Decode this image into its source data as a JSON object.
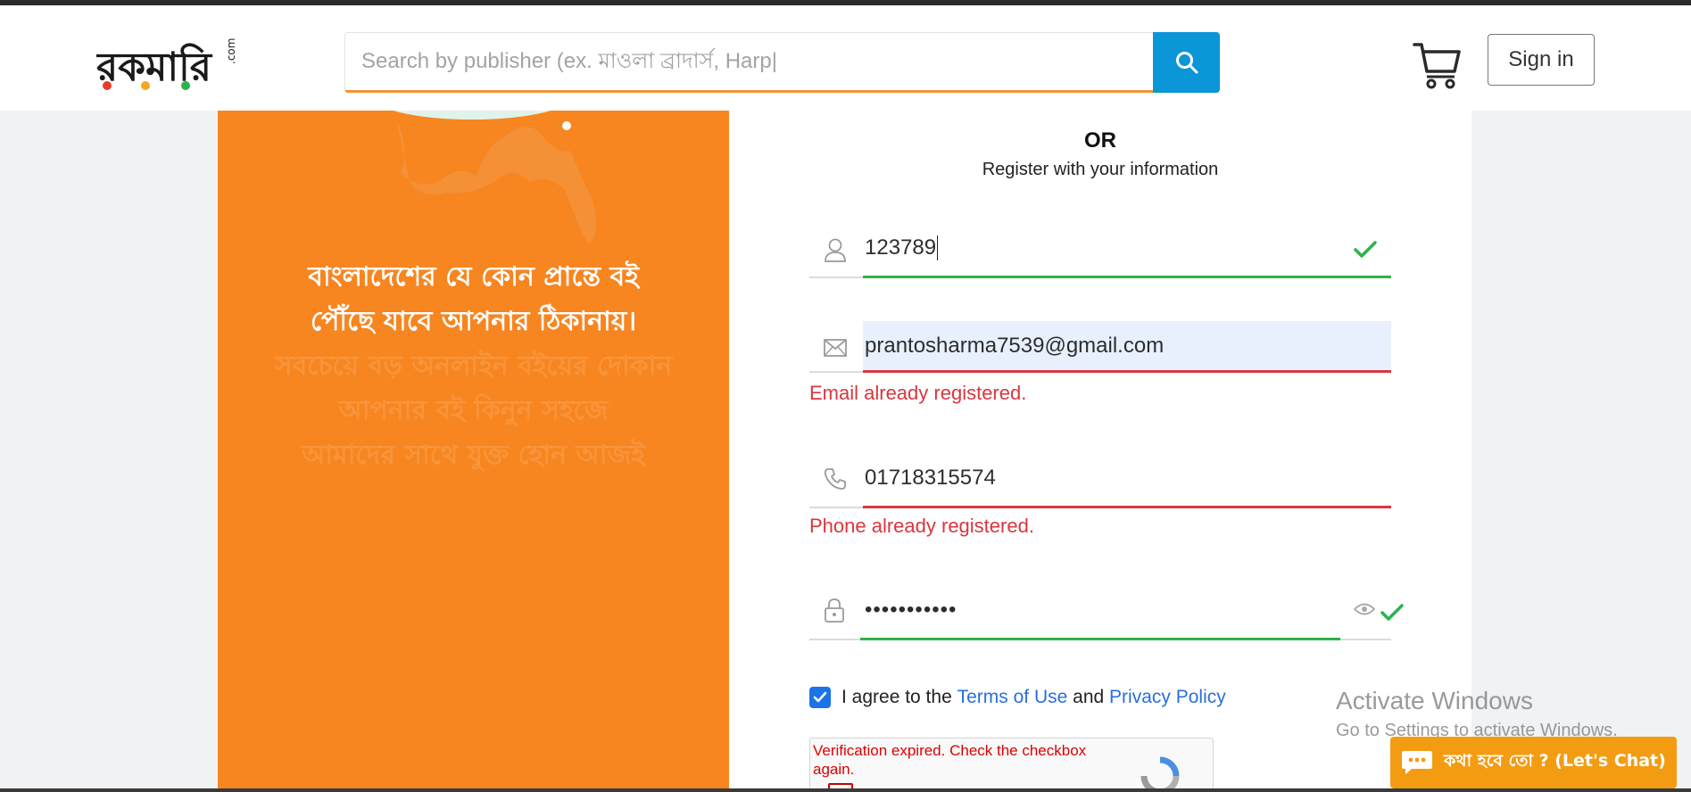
{
  "header": {
    "logo_text": "রকমারি",
    "logo_suffix": ".com",
    "search": {
      "placeholder": "Search by publisher (ex. মাওলা ব্রাদার্স, Harp|"
    },
    "signin_label": "Sign in"
  },
  "left_panel": {
    "line1": "বাংলাদেশের যে কোন প্রান্তে বই",
    "line2": "পৌঁছে যাবে আপনার ঠিকানায়।",
    "faded_lines": [
      "সবচেয়ে বড় অনলাইন বইয়ের দোকান",
      "আপনার বই কিনুন সহজে",
      "আমাদের সাথে যুক্ত হোন আজই"
    ]
  },
  "form": {
    "or_text": "OR",
    "subtitle": "Register with your information",
    "name_value": "123789",
    "email_value": "prantosharma7539@gmail.com",
    "email_error": "Email already registered.",
    "phone_value": "01718315574",
    "phone_error": "Phone already registered.",
    "password_value": "•••••••••••",
    "agree_prefix": "I agree to the",
    "terms_label": "Terms of Use",
    "agree_and": "and",
    "privacy_label": "Privacy Policy",
    "recaptcha_msg": "Verification expired. Check the checkbox again."
  },
  "watermark": {
    "line1": "Activate Windows",
    "line2": "Go to Settings to activate Windows."
  },
  "chat": {
    "label": "কথা হবে তো ? (Let's Chat)"
  },
  "colors": {
    "accent_orange": "#f78620",
    "search_blue": "#0b96d8",
    "success": "#2bb34a",
    "error": "#d9363e"
  }
}
